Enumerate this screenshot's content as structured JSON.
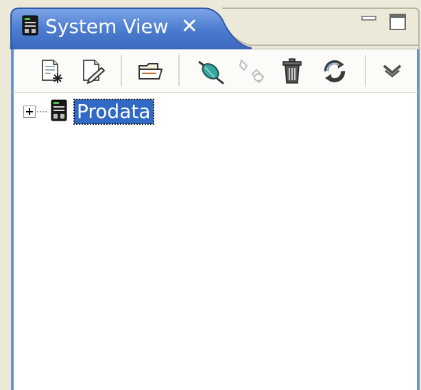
{
  "view": {
    "title": "System View",
    "close_glyph": "✕",
    "controls": [
      {
        "name": "minimize-icon"
      },
      {
        "name": "maximize-icon"
      }
    ]
  },
  "toolbar": {
    "buttons": [
      {
        "name": "new-system-icon",
        "enabled": true
      },
      {
        "name": "edit-system-icon",
        "enabled": true
      },
      {
        "name": "open-folder-icon",
        "enabled": true
      },
      {
        "name": "connect-icon",
        "enabled": true
      },
      {
        "name": "disconnect-icon",
        "enabled": false
      },
      {
        "name": "trash-icon",
        "enabled": true
      },
      {
        "name": "refresh-icon",
        "enabled": true
      },
      {
        "name": "view-menu-icon",
        "enabled": true
      }
    ]
  },
  "tree": {
    "nodes": [
      {
        "label": "Prodata",
        "icon": "server-icon",
        "expanded": false,
        "selected": true
      }
    ]
  },
  "colors": {
    "tab_blue": "#4a79c9",
    "selection": "#316ac5",
    "frame_border": "#6f94c9",
    "background": "#ece9d8"
  }
}
